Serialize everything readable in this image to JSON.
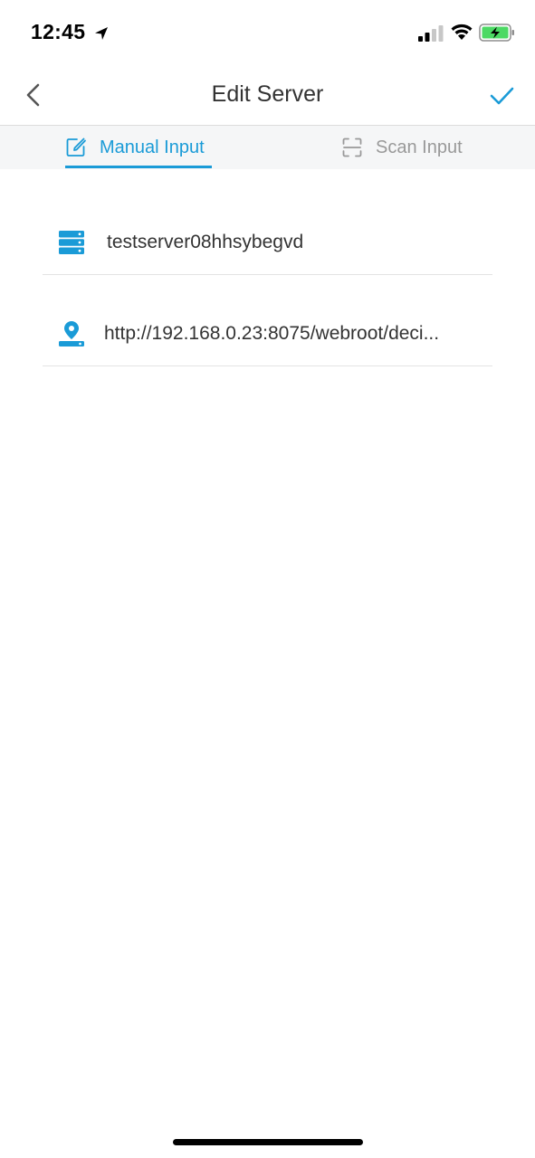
{
  "status_bar": {
    "time": "12:45"
  },
  "nav": {
    "title": "Edit Server"
  },
  "tabs": [
    {
      "label": "Manual Input",
      "active": true,
      "icon": "edit-icon"
    },
    {
      "label": "Scan Input",
      "active": false,
      "icon": "scan-icon"
    }
  ],
  "form": {
    "server_name": "testserver08hhsybegvd",
    "server_url": "http://192.168.0.23:8075/webroot/deci..."
  },
  "colors": {
    "accent": "#1a9bd7",
    "inactive": "#999999",
    "text": "#333333"
  }
}
